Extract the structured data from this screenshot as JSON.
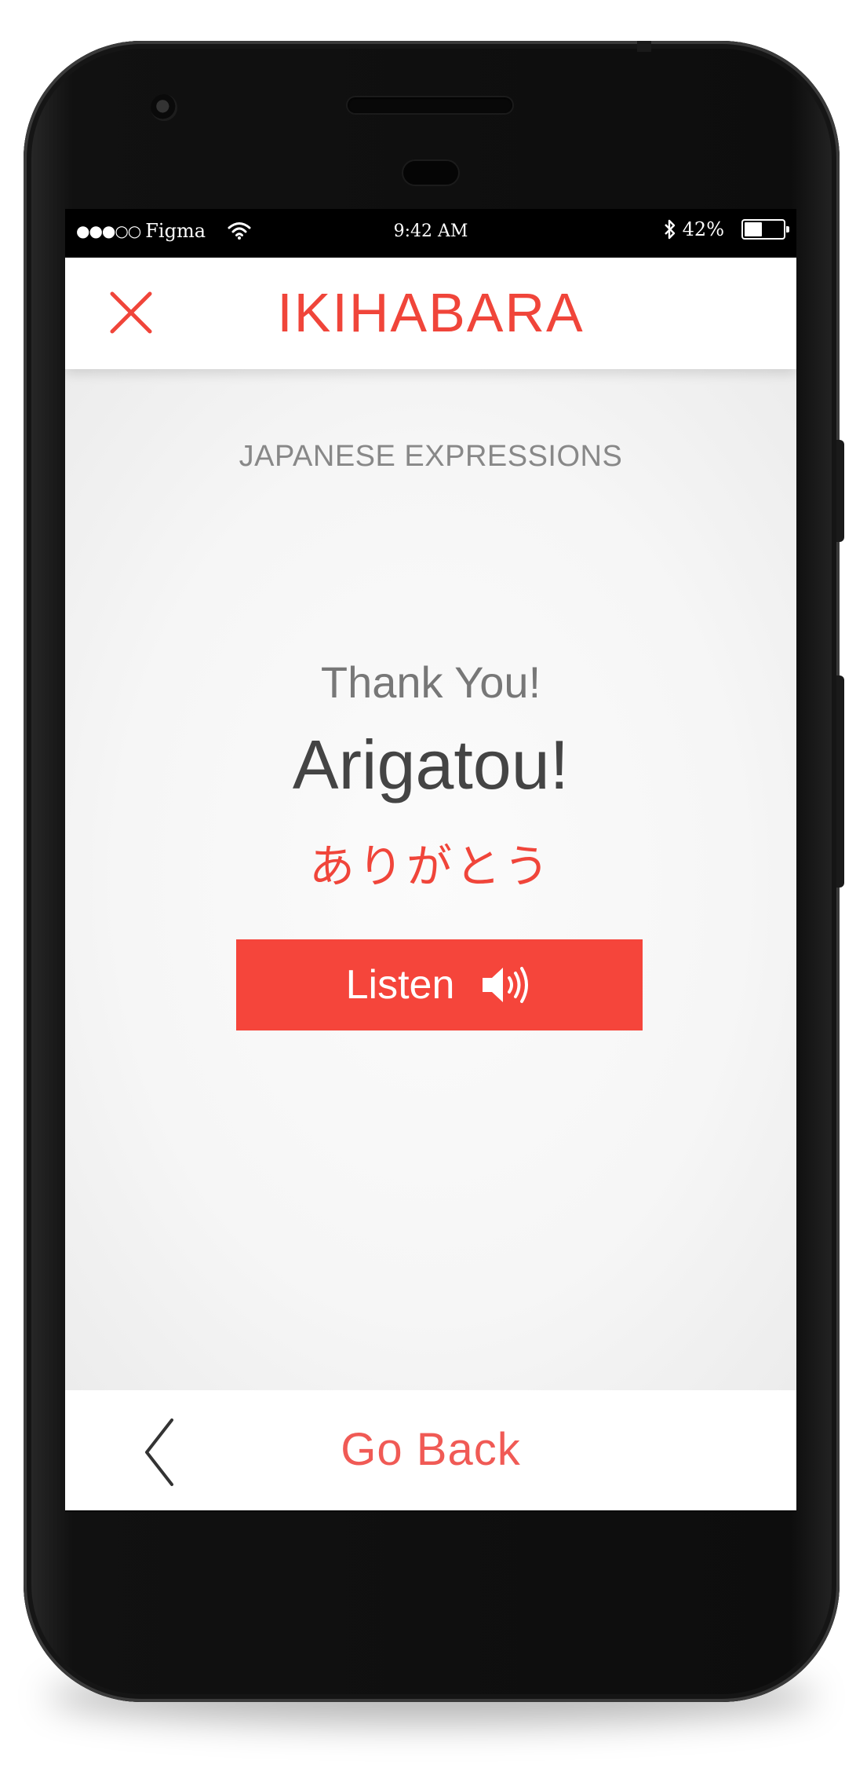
{
  "status_bar": {
    "carrier": "Figma",
    "signal": "●●●○○",
    "time": "9:42 AM",
    "battery_percent": "42%",
    "battery_level": 0.42
  },
  "header": {
    "title": "IKIHABARA",
    "close_icon": "close-x-icon"
  },
  "content": {
    "category": "JAPANESE EXPRESSIONS",
    "english": "Thank You!",
    "romaji": "Arigatou!",
    "japanese": "ありがとう",
    "listen_label": "Listen",
    "listen_icon": "speaker-volume-icon"
  },
  "footer": {
    "back_label": "Go Back",
    "back_icon": "chevron-left-icon"
  },
  "colors": {
    "accent": "#f0453a",
    "button": "#f5453b",
    "background": "#f6f6f6"
  }
}
